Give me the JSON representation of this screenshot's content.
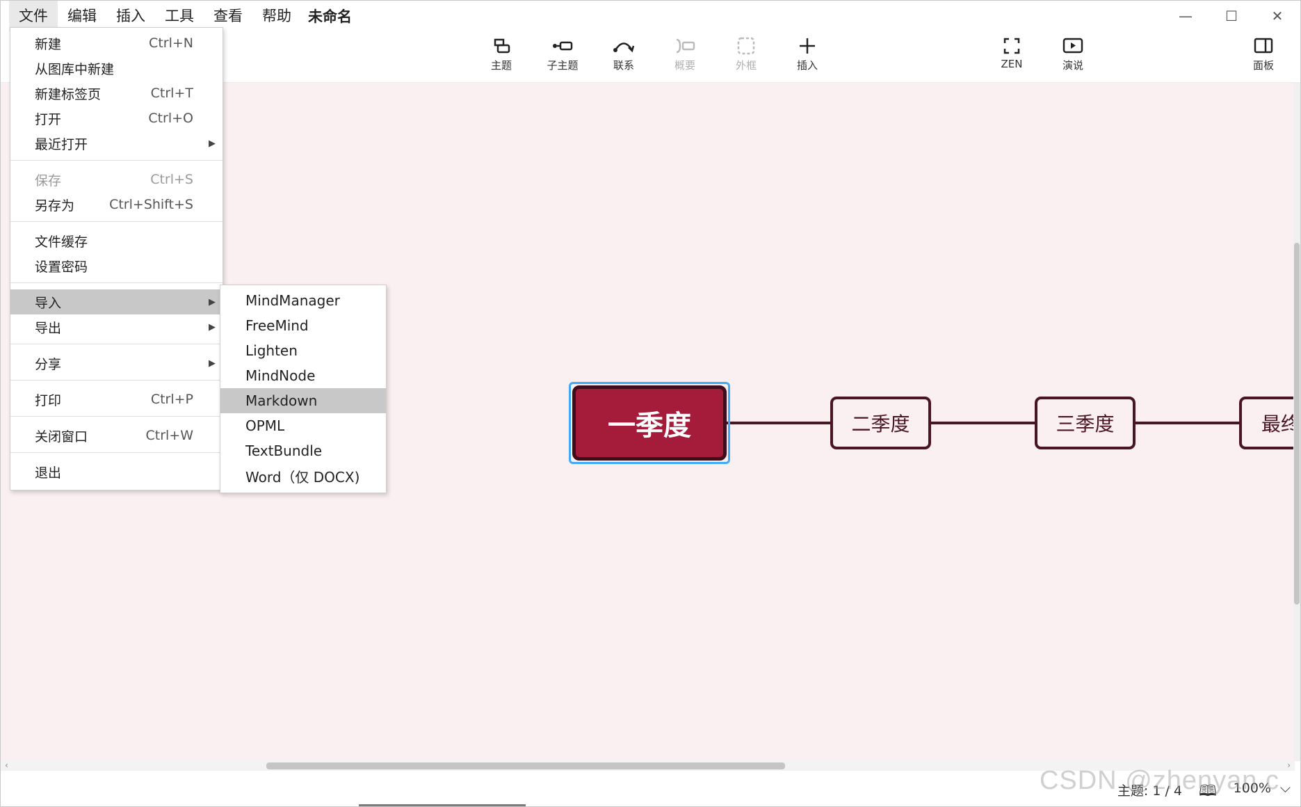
{
  "menubar": {
    "items": [
      "文件",
      "编辑",
      "插入",
      "工具",
      "查看",
      "帮助"
    ],
    "doc_title": "未命名"
  },
  "window_controls": {
    "minimize": "—",
    "maximize": "☐",
    "close": "✕"
  },
  "toolbar": {
    "topic": "主题",
    "subtopic": "子主题",
    "relationship": "联系",
    "summary": "概要",
    "boundary": "外框",
    "insert": "插入",
    "zen": "ZEN",
    "present": "演说",
    "panel": "面板"
  },
  "file_menu": {
    "items": [
      {
        "label": "新建",
        "shortcut": "Ctrl+N"
      },
      {
        "label": "从图库中新建",
        "shortcut": ""
      },
      {
        "label": "新建标签页",
        "shortcut": "Ctrl+T"
      },
      {
        "label": "打开",
        "shortcut": "Ctrl+O"
      },
      {
        "label": "最近打开",
        "shortcut": ""
      },
      {
        "label": "保存",
        "shortcut": "Ctrl+S"
      },
      {
        "label": "另存为",
        "shortcut": "Ctrl+Shift+S"
      },
      {
        "label": "文件缓存",
        "shortcut": ""
      },
      {
        "label": "设置密码",
        "shortcut": ""
      },
      {
        "label": "导入",
        "shortcut": ""
      },
      {
        "label": "导出",
        "shortcut": ""
      },
      {
        "label": "分享",
        "shortcut": ""
      },
      {
        "label": "打印",
        "shortcut": "Ctrl+P"
      },
      {
        "label": "关闭窗口",
        "shortcut": "Ctrl+W"
      },
      {
        "label": "退出",
        "shortcut": ""
      }
    ]
  },
  "import_menu": {
    "items": [
      "MindManager",
      "FreeMind",
      "Lighten",
      "MindNode",
      "Markdown",
      "OPML",
      "TextBundle",
      "Word（仅 DOCX)"
    ]
  },
  "mindmap": {
    "central": "一季度",
    "topics": [
      "二季度",
      "三季度",
      "最终"
    ]
  },
  "statusbar": {
    "topics": "主题: 1 / 4",
    "zoom": "100%"
  },
  "watermark": "CSDN @zhenyan.c"
}
